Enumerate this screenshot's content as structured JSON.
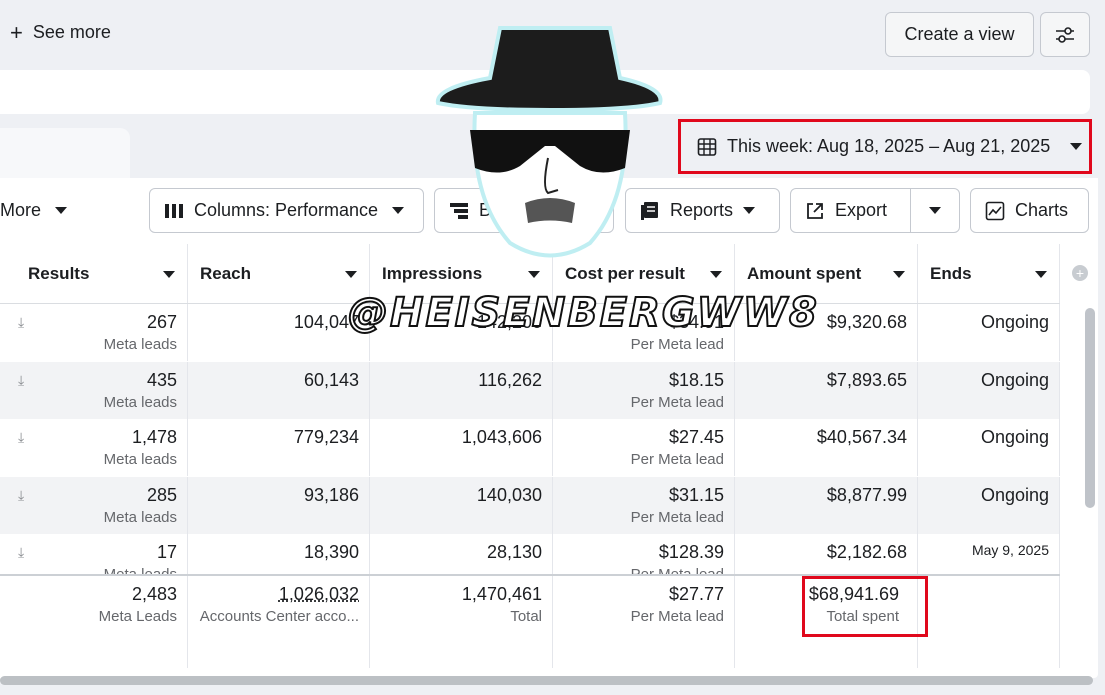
{
  "topbar": {
    "see_more": "See more",
    "create_view": "Create a view"
  },
  "date_range": {
    "label": "This week: Aug 18, 2025 – Aug 21, 2025"
  },
  "toolbar": {
    "more": "More",
    "columns": "Columns: Performance",
    "breakdown": "B",
    "reports": "Reports",
    "export": "Export",
    "charts": "Charts"
  },
  "table": {
    "headers": [
      "Results",
      "Reach",
      "Impressions",
      "Cost per result",
      "Amount spent",
      "Ends"
    ],
    "rows": [
      {
        "results": "267",
        "results_sub": "Meta leads",
        "reach": "104,047",
        "impressions": "142,200",
        "cpr": "$34.91",
        "cpr_sub": "Per Meta lead",
        "spent": "$9,320.68",
        "ends": "Ongoing"
      },
      {
        "results": "435",
        "results_sub": "Meta leads",
        "reach": "60,143",
        "impressions": "116,262",
        "cpr": "$18.15",
        "cpr_sub": "Per Meta lead",
        "spent": "$7,893.65",
        "ends": "Ongoing"
      },
      {
        "results": "1,478",
        "results_sub": "Meta leads",
        "reach": "779,234",
        "impressions": "1,043,606",
        "cpr": "$27.45",
        "cpr_sub": "Per Meta lead",
        "spent": "$40,567.34",
        "ends": "Ongoing"
      },
      {
        "results": "285",
        "results_sub": "Meta leads",
        "reach": "93,186",
        "impressions": "140,030",
        "cpr": "$31.15",
        "cpr_sub": "Per Meta lead",
        "spent": "$8,877.99",
        "ends": "Ongoing"
      },
      {
        "results": "17",
        "results_sub": "Meta leads",
        "reach": "18,390",
        "impressions": "28,130",
        "cpr": "$128.39",
        "cpr_sub": "Per Meta lead",
        "spent": "$2,182.68",
        "ends": "May 9, 2025"
      }
    ],
    "totals": {
      "results": "2,483",
      "results_sub": "Meta Leads",
      "reach": "1,026,032",
      "reach_sub": "Accounts Center acco...",
      "impressions": "1,470,461",
      "impressions_sub": "Total",
      "cpr": "$27.77",
      "cpr_sub": "Per Meta lead",
      "spent": "$68,941.69",
      "spent_sub": "Total spent"
    }
  },
  "watermark": "@HEISENBERGWW8",
  "colors": {
    "highlight": "#e0081c",
    "panel": "#ffffff",
    "bg": "#eef0f4"
  }
}
